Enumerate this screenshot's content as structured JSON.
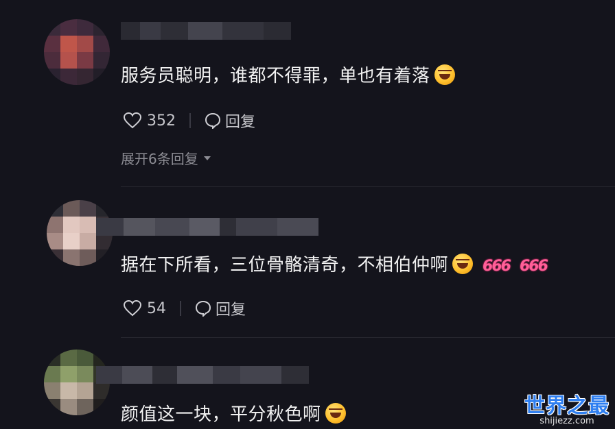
{
  "comments": [
    {
      "text": "服务员聪明，谁都不得罪，单也有着落",
      "emoji": "laugh-emoji",
      "likes": "352",
      "reply_label": "回复",
      "expand_label": "展开6条回复"
    },
    {
      "text": "据在下所看，三位骨骼清奇，不相伯仲啊",
      "emoji": "laugh-emoji",
      "stickers": [
        "666",
        "666"
      ],
      "likes": "54",
      "reply_label": "回复"
    },
    {
      "text": "颜值这一块，平分秋色啊",
      "emoji": "laugh-emoji"
    }
  ],
  "watermark": {
    "title": "世界之最",
    "subtitle": "shijiezz.com"
  },
  "colors": {
    "background": "#14141c",
    "sticker": "#ff5f98",
    "watermark": "#2f7ff0"
  }
}
